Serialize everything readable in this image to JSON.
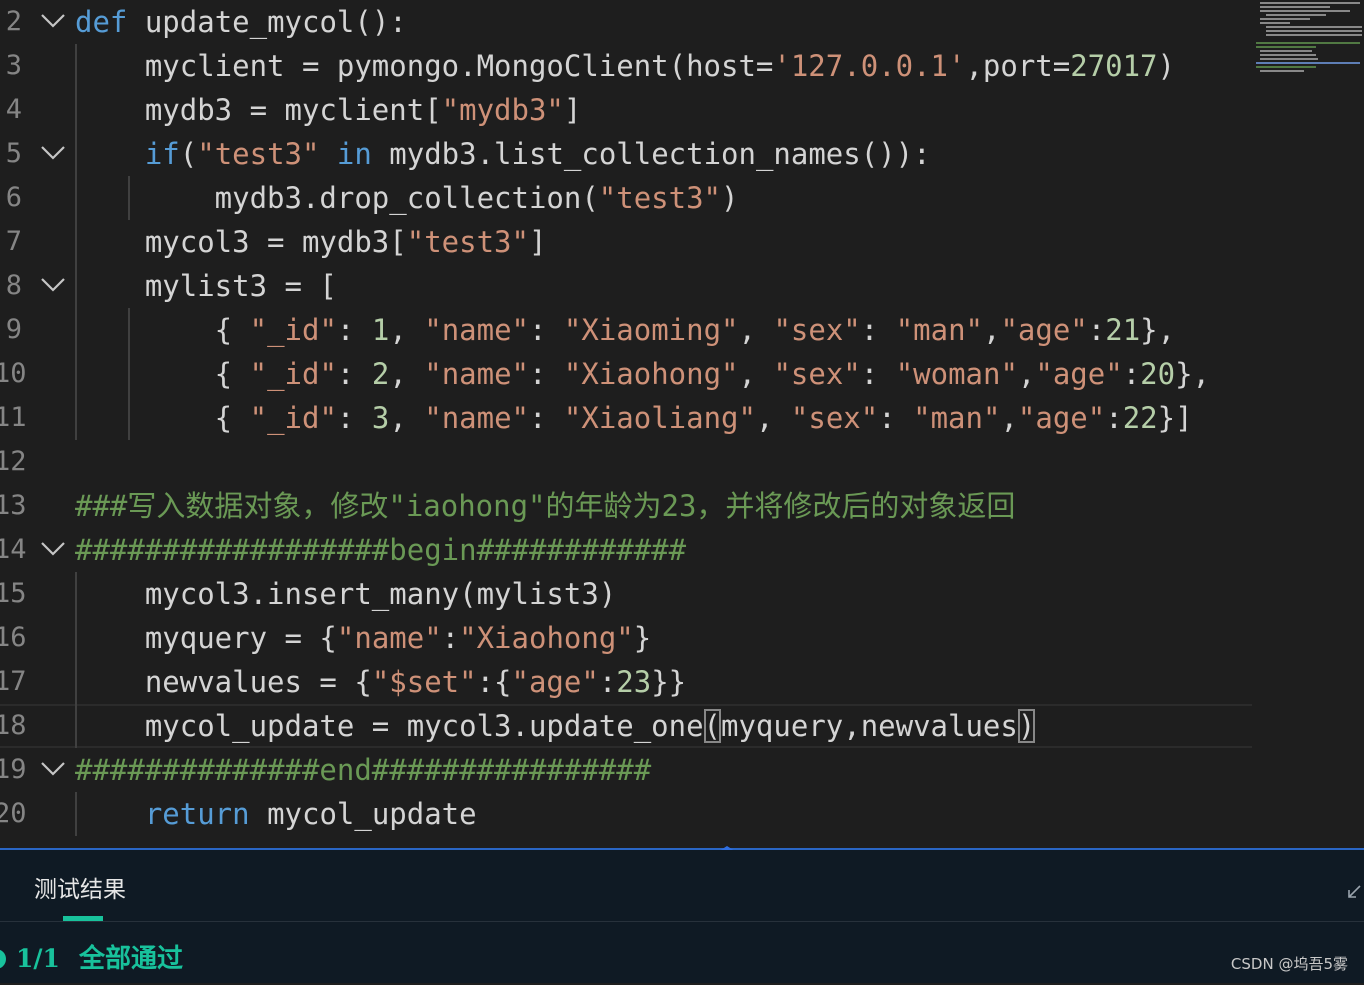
{
  "editor": {
    "lines": [
      {
        "num": "2",
        "fold": true,
        "segments": [
          {
            "t": "def",
            "c": "kw"
          },
          {
            "t": " update_mycol():",
            "c": "plain"
          }
        ]
      },
      {
        "num": "3",
        "fold": false,
        "segments": [
          {
            "t": "    myclient = pymongo.MongoClient(host=",
            "c": "plain"
          },
          {
            "t": "'127.0.0.1'",
            "c": "str"
          },
          {
            "t": ",port=",
            "c": "plain"
          },
          {
            "t": "27017",
            "c": "num"
          },
          {
            "t": ")",
            "c": "plain"
          }
        ]
      },
      {
        "num": "4",
        "fold": false,
        "segments": [
          {
            "t": "    mydb3 = myclient[",
            "c": "plain"
          },
          {
            "t": "\"mydb3\"",
            "c": "str"
          },
          {
            "t": "]",
            "c": "plain"
          }
        ]
      },
      {
        "num": "5",
        "fold": true,
        "segments": [
          {
            "t": "    ",
            "c": "plain"
          },
          {
            "t": "if",
            "c": "kw"
          },
          {
            "t": "(",
            "c": "plain"
          },
          {
            "t": "\"test3\"",
            "c": "str"
          },
          {
            "t": " ",
            "c": "plain"
          },
          {
            "t": "in",
            "c": "kw"
          },
          {
            "t": " mydb3.list_collection_names()):",
            "c": "plain"
          }
        ]
      },
      {
        "num": "6",
        "fold": false,
        "segments": [
          {
            "t": "        mydb3.drop_collection(",
            "c": "plain"
          },
          {
            "t": "\"test3\"",
            "c": "str"
          },
          {
            "t": ")",
            "c": "plain"
          }
        ]
      },
      {
        "num": "7",
        "fold": false,
        "segments": [
          {
            "t": "    mycol3 = mydb3[",
            "c": "plain"
          },
          {
            "t": "\"test3\"",
            "c": "str"
          },
          {
            "t": "]",
            "c": "plain"
          }
        ]
      },
      {
        "num": "8",
        "fold": true,
        "segments": [
          {
            "t": "    mylist3 = [",
            "c": "plain"
          }
        ]
      },
      {
        "num": "9",
        "fold": false,
        "segments": [
          {
            "t": "        { ",
            "c": "plain"
          },
          {
            "t": "\"_id\"",
            "c": "str"
          },
          {
            "t": ": ",
            "c": "plain"
          },
          {
            "t": "1",
            "c": "num"
          },
          {
            "t": ", ",
            "c": "plain"
          },
          {
            "t": "\"name\"",
            "c": "str"
          },
          {
            "t": ": ",
            "c": "plain"
          },
          {
            "t": "\"Xiaoming\"",
            "c": "str"
          },
          {
            "t": ", ",
            "c": "plain"
          },
          {
            "t": "\"sex\"",
            "c": "str"
          },
          {
            "t": ": ",
            "c": "plain"
          },
          {
            "t": "\"man\"",
            "c": "str"
          },
          {
            "t": ",",
            "c": "plain"
          },
          {
            "t": "\"age\"",
            "c": "str"
          },
          {
            "t": ":",
            "c": "plain"
          },
          {
            "t": "21",
            "c": "num"
          },
          {
            "t": "},",
            "c": "plain"
          }
        ]
      },
      {
        "num": "10",
        "fold": false,
        "segments": [
          {
            "t": "        { ",
            "c": "plain"
          },
          {
            "t": "\"_id\"",
            "c": "str"
          },
          {
            "t": ": ",
            "c": "plain"
          },
          {
            "t": "2",
            "c": "num"
          },
          {
            "t": ", ",
            "c": "plain"
          },
          {
            "t": "\"name\"",
            "c": "str"
          },
          {
            "t": ": ",
            "c": "plain"
          },
          {
            "t": "\"Xiaohong\"",
            "c": "str"
          },
          {
            "t": ", ",
            "c": "plain"
          },
          {
            "t": "\"sex\"",
            "c": "str"
          },
          {
            "t": ": ",
            "c": "plain"
          },
          {
            "t": "\"woman\"",
            "c": "str"
          },
          {
            "t": ",",
            "c": "plain"
          },
          {
            "t": "\"age\"",
            "c": "str"
          },
          {
            "t": ":",
            "c": "plain"
          },
          {
            "t": "20",
            "c": "num"
          },
          {
            "t": "},",
            "c": "plain"
          }
        ]
      },
      {
        "num": "11",
        "fold": false,
        "segments": [
          {
            "t": "        { ",
            "c": "plain"
          },
          {
            "t": "\"_id\"",
            "c": "str"
          },
          {
            "t": ": ",
            "c": "plain"
          },
          {
            "t": "3",
            "c": "num"
          },
          {
            "t": ", ",
            "c": "plain"
          },
          {
            "t": "\"name\"",
            "c": "str"
          },
          {
            "t": ": ",
            "c": "plain"
          },
          {
            "t": "\"Xiaoliang\"",
            "c": "str"
          },
          {
            "t": ", ",
            "c": "plain"
          },
          {
            "t": "\"sex\"",
            "c": "str"
          },
          {
            "t": ": ",
            "c": "plain"
          },
          {
            "t": "\"man\"",
            "c": "str"
          },
          {
            "t": ",",
            "c": "plain"
          },
          {
            "t": "\"age\"",
            "c": "str"
          },
          {
            "t": ":",
            "c": "plain"
          },
          {
            "t": "22",
            "c": "num"
          },
          {
            "t": "}]",
            "c": "plain"
          }
        ]
      },
      {
        "num": "12",
        "fold": false,
        "segments": []
      },
      {
        "num": "13",
        "fold": false,
        "segments": [
          {
            "t": "###写入数据对象，修改\"iaohong\"的年龄为23，并将修改后的对象返回",
            "c": "cm"
          }
        ]
      },
      {
        "num": "14",
        "fold": true,
        "segments": [
          {
            "t": "##################begin############",
            "c": "cm"
          }
        ]
      },
      {
        "num": "15",
        "fold": false,
        "segments": [
          {
            "t": "    mycol3.insert_many(mylist3)",
            "c": "plain"
          }
        ]
      },
      {
        "num": "16",
        "fold": false,
        "segments": [
          {
            "t": "    myquery = {",
            "c": "plain"
          },
          {
            "t": "\"name\"",
            "c": "str"
          },
          {
            "t": ":",
            "c": "plain"
          },
          {
            "t": "\"Xiaohong\"",
            "c": "str"
          },
          {
            "t": "}",
            "c": "plain"
          }
        ]
      },
      {
        "num": "17",
        "fold": false,
        "segments": [
          {
            "t": "    newvalues = {",
            "c": "plain"
          },
          {
            "t": "\"$set\"",
            "c": "str"
          },
          {
            "t": ":{",
            "c": "plain"
          },
          {
            "t": "\"age\"",
            "c": "str"
          },
          {
            "t": ":",
            "c": "plain"
          },
          {
            "t": "23",
            "c": "num"
          },
          {
            "t": "}}",
            "c": "plain"
          }
        ]
      },
      {
        "num": "18",
        "fold": false,
        "current": true,
        "segments": [
          {
            "t": "    mycol_update = mycol3.update_one",
            "c": "plain"
          },
          {
            "t": "(",
            "c": "bracket"
          },
          {
            "t": "myquery,newvalues",
            "c": "plain"
          },
          {
            "t": ")",
            "c": "bracket"
          }
        ]
      },
      {
        "num": "19",
        "fold": true,
        "segments": [
          {
            "t": "##############end################",
            "c": "cm"
          }
        ]
      },
      {
        "num": "20",
        "fold": false,
        "segments": [
          {
            "t": "    ",
            "c": "plain"
          },
          {
            "t": "return",
            "c": "kw"
          },
          {
            "t": " mycol_update",
            "c": "plain"
          }
        ]
      }
    ]
  },
  "panel": {
    "tab_label": "测试结果",
    "result_count": "1/1",
    "result_text": "全部通过",
    "watermark": "CSDN @坞吾5雾"
  },
  "colors": {
    "background": "#1e1e1e",
    "keyword": "#569cd6",
    "string": "#ce9178",
    "number": "#b5cea8",
    "comment": "#6a9955",
    "success": "#18c29c",
    "splitter": "#2a66c4"
  },
  "icons": [
    "chevron-down-icon",
    "splitter-drag-icon",
    "collapse-icon",
    "status-circle-icon"
  ]
}
